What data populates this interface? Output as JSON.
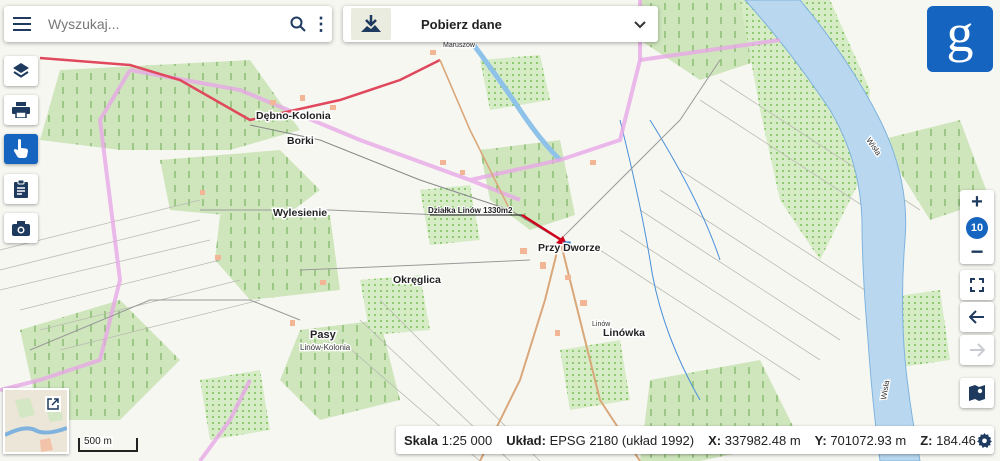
{
  "search": {
    "placeholder": "Wyszukaj..."
  },
  "download": {
    "label": "Pobierz dane"
  },
  "map": {
    "places": {
      "debno_kolonia": "Dębno-Kolonia",
      "borki": "Borki",
      "wylesienie": "Wylesienie",
      "okreglica": "Okręglica",
      "pasy": "Pasy",
      "linow_kolonia": "Linów-Kolonia",
      "przy_dworze": "Przy Dworze",
      "linowka": "Linówka",
      "linow_small": "Linów",
      "maruszow": "Maruszów",
      "wisla_1": "Wisła",
      "wisla_2": "Wisła"
    },
    "parcel_label": "Działka Linów 1330m2"
  },
  "zoom": {
    "level": "10"
  },
  "scale_bar": {
    "label": "500 m"
  },
  "status": {
    "scale_label": "Skala",
    "scale_value": "1:25 000",
    "crs_label": "Układ:",
    "crs_value": "EPSG 2180 (układ 1992)",
    "x_label": "X:",
    "x_value": "337982.48 m",
    "y_label": "Y:",
    "y_value": "701072.93 m",
    "z_label": "Z:",
    "z_value": "184.46"
  },
  "colors": {
    "accent": "#1565c0",
    "forest": "#c9e4b8",
    "river": "#b9d8f0",
    "road_red": "#e0485d",
    "boundary": "#e6a8e6"
  }
}
